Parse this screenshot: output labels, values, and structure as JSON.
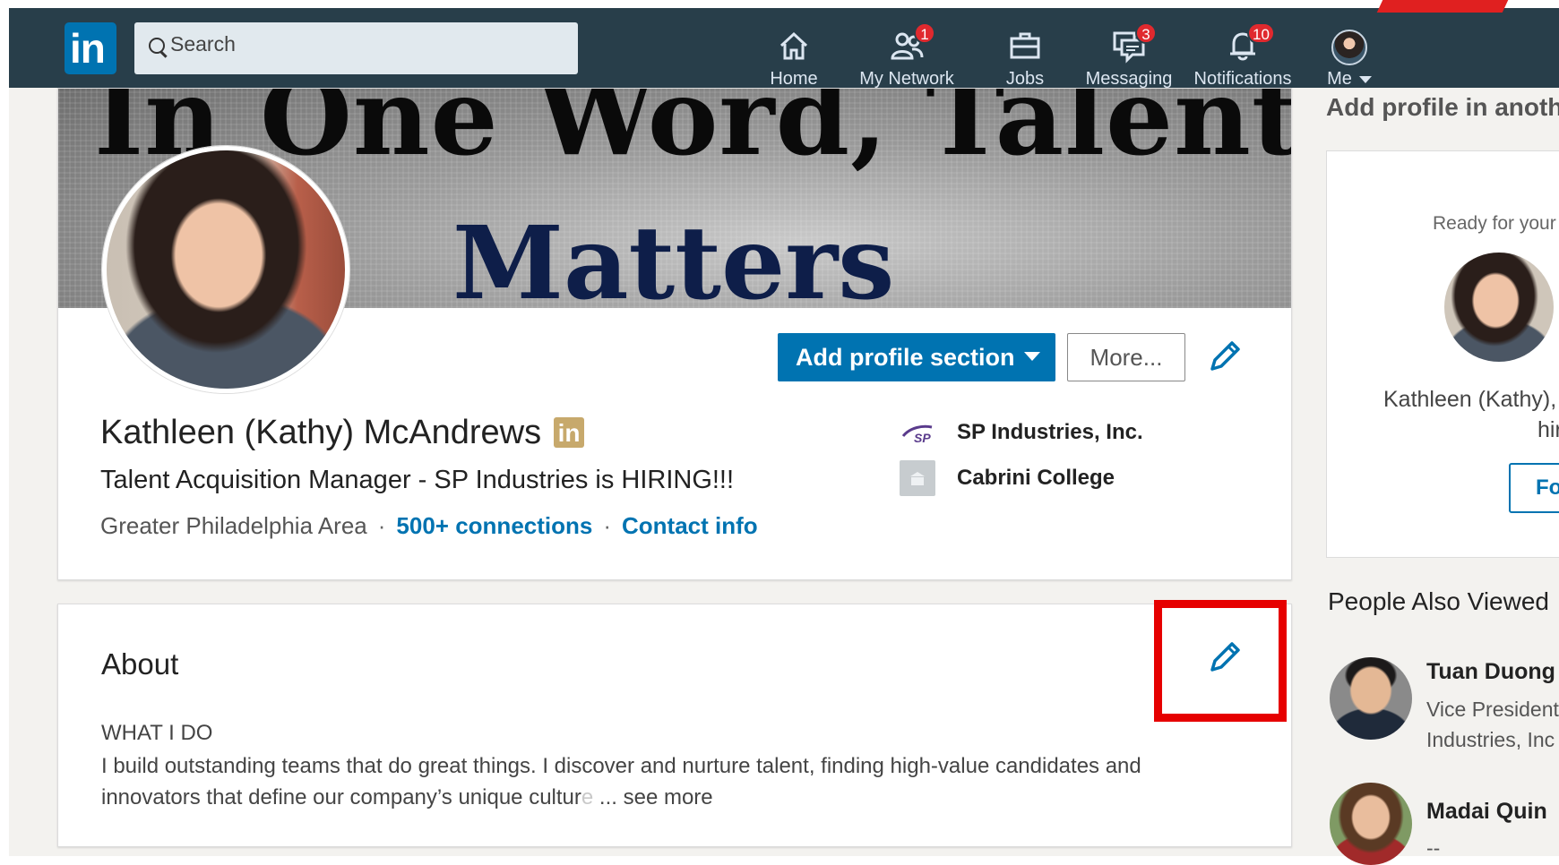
{
  "nav": {
    "search_placeholder": "Search",
    "items": [
      {
        "label": "Home",
        "icon": "home-icon"
      },
      {
        "label": "My Network",
        "icon": "my-network-icon",
        "badge": "1"
      },
      {
        "label": "Jobs",
        "icon": "jobs-icon"
      },
      {
        "label": "Messaging",
        "icon": "messaging-icon",
        "badge": "3"
      },
      {
        "label": "Notifications",
        "icon": "notifications-icon",
        "badge": "10"
      },
      {
        "label": "Me",
        "icon": "me-avatar"
      }
    ]
  },
  "profile": {
    "banner_line1": "In One Word, Talent",
    "banner_line2": "Matters",
    "name": "Kathleen (Kathy) McAndrews",
    "headline": "Talent Acquisition Manager - SP Industries is HIRING!!!",
    "location": "Greater Philadelphia Area",
    "connections": "500+ connections",
    "contact": "Contact info",
    "add_section_label": "Add profile section",
    "more_label": "More...",
    "experience": [
      {
        "name": "SP Industries, Inc.",
        "logo_text": "SP"
      },
      {
        "name": "Cabrini College"
      }
    ]
  },
  "about": {
    "title": "About",
    "heading": "WHAT I DO",
    "line1": "I build outstanding teams that do great things. I discover and nurture talent, finding high-value candidates and",
    "line2_main": "innovators that define our company’s unique cultur",
    "line2_fade": "e",
    "see_more": " ... see more"
  },
  "rail": {
    "add_profile_title": "Add profile in anothe",
    "ready_text": "Ready for your",
    "name_line1": "Kathleen (Kathy),",
    "name_line2": "hir",
    "follow_label": "Fo",
    "people_title": "People Also Viewed",
    "people": [
      {
        "name": "Tuan Duong",
        "sub1": "Vice President",
        "sub2": "Industries, Inc"
      },
      {
        "name": "Madai Quin",
        "sub1": "--"
      }
    ]
  },
  "colors": {
    "nav_bg": "#283e4a",
    "brand_blue": "#0073b1",
    "badge_red": "#e0292e",
    "highlight_red": "#e60000"
  }
}
